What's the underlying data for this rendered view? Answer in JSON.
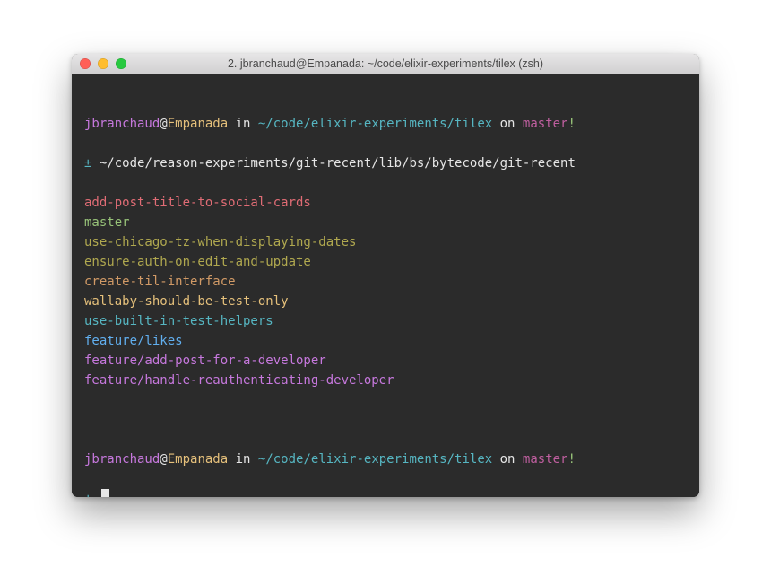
{
  "window": {
    "title": "2. jbranchaud@Empanada: ~/code/elixir-experiments/tilex (zsh)"
  },
  "colors": {
    "red": "#e06c75",
    "green": "#98c379",
    "yellow": "#e5c07b",
    "blue": "#61afef",
    "magenta": "#c678dd",
    "cyan": "#56b6c2",
    "olive": "#b0a84f",
    "orange": "#d19a66",
    "fg": "#e6e6e6"
  },
  "prompt1": {
    "user": "jbranchaud",
    "at": "@",
    "host": "Empanada",
    "in": " in ",
    "path": "~/code/elixir-experiments/tilex",
    "on": " on ",
    "branch": "master",
    "bang": "!",
    "symbol": "±",
    "command": "~/code/reason-experiments/git-recent/lib/bs/bytecode/git-recent"
  },
  "output_lines": [
    {
      "text": "add-post-title-to-social-cards",
      "color": "red"
    },
    {
      "text": "master",
      "color": "green"
    },
    {
      "text": "use-chicago-tz-when-displaying-dates",
      "color": "olive"
    },
    {
      "text": "ensure-auth-on-edit-and-update",
      "color": "olive"
    },
    {
      "text": "create-til-interface",
      "color": "orange"
    },
    {
      "text": "wallaby-should-be-test-only",
      "color": "yellow"
    },
    {
      "text": "use-built-in-test-helpers",
      "color": "cyan"
    },
    {
      "text": "feature/likes",
      "color": "blue"
    },
    {
      "text": "feature/add-post-for-a-developer",
      "color": "magenta"
    },
    {
      "text": "feature/handle-reauthenticating-developer",
      "color": "magenta"
    }
  ],
  "prompt2": {
    "user": "jbranchaud",
    "at": "@",
    "host": "Empanada",
    "in": " in ",
    "path": "~/code/elixir-experiments/tilex",
    "on": " on ",
    "branch": "master",
    "bang": "!",
    "symbol": "±"
  }
}
